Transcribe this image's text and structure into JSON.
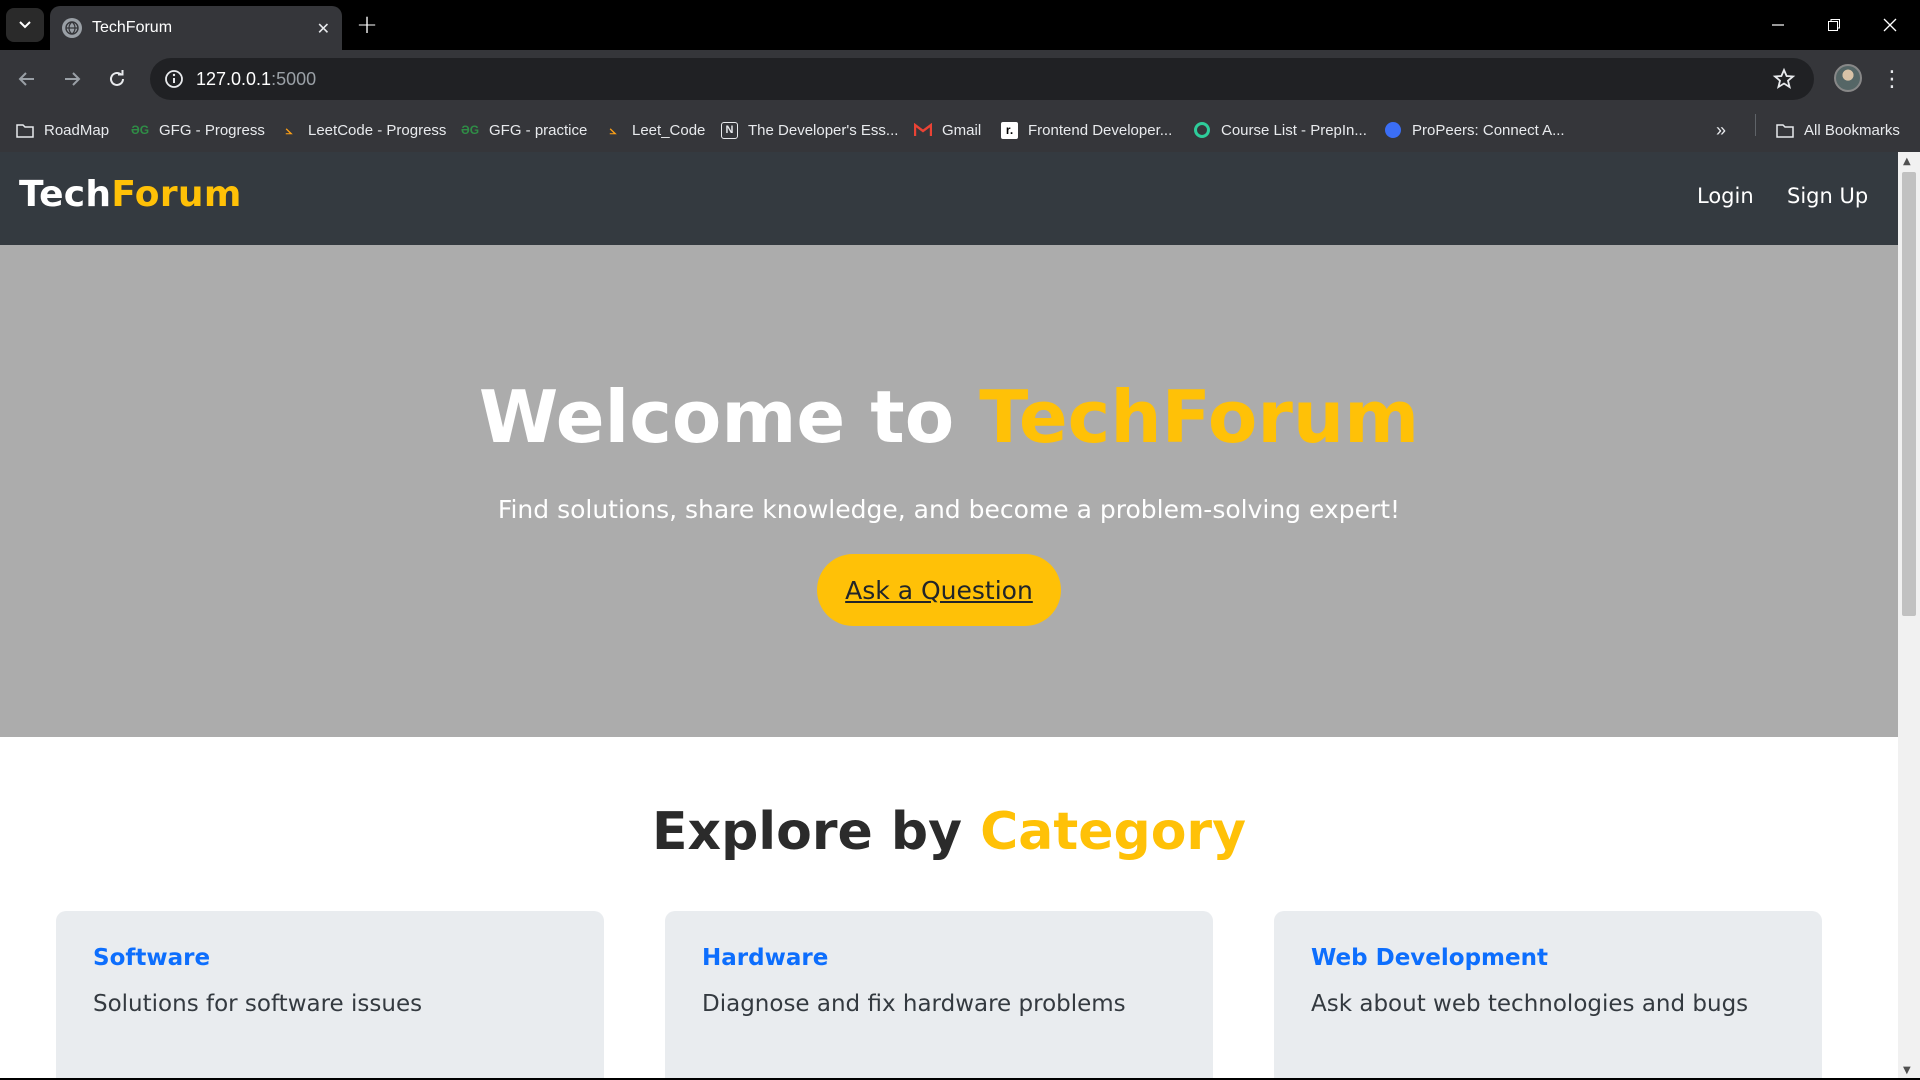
{
  "browser": {
    "tab_title": "TechForum",
    "url_host": "127.0.0.1",
    "url_port": ":5000",
    "bookmarks": [
      {
        "label": "RoadMap",
        "icon": "folder-icon"
      },
      {
        "label": "GFG - Progress",
        "icon": "gfg-icon"
      },
      {
        "label": "LeetCode - Progress",
        "icon": "leetcode-icon"
      },
      {
        "label": "GFG - practice",
        "icon": "gfg-icon"
      },
      {
        "label": "Leet_Code",
        "icon": "leetcode-icon"
      },
      {
        "label": "The Developer's Ess...",
        "icon": "notion-icon"
      },
      {
        "label": "Gmail",
        "icon": "gmail-icon"
      },
      {
        "label": "Frontend Developer...",
        "icon": "roadmap-icon"
      },
      {
        "label": "Course List - PrepIn...",
        "icon": "prepinsta-icon"
      },
      {
        "label": "ProPeers: Connect A...",
        "icon": "propeers-icon"
      }
    ],
    "all_bookmarks": "All Bookmarks"
  },
  "site": {
    "brand_main": "Tech",
    "brand_accent": "Forum",
    "nav": {
      "login": "Login",
      "signup": "Sign Up"
    },
    "hero": {
      "title_main": "Welcome to ",
      "title_accent": "TechForum",
      "lead": "Find solutions, share knowledge, and become a problem-solving expert!",
      "cta": "Ask a Question"
    },
    "categories_heading_main": "Explore by ",
    "categories_heading_accent": "Category",
    "categories": [
      {
        "title": "Software",
        "desc": "Solutions for software issues"
      },
      {
        "title": "Hardware",
        "desc": "Diagnose and fix hardware problems"
      },
      {
        "title": "Web Development",
        "desc": "Ask about web technologies and bugs"
      }
    ]
  },
  "colors": {
    "accent": "#ffc107",
    "nav_bg": "#343a40",
    "hero_bg": "#acacac",
    "link": "#0d6efd"
  }
}
